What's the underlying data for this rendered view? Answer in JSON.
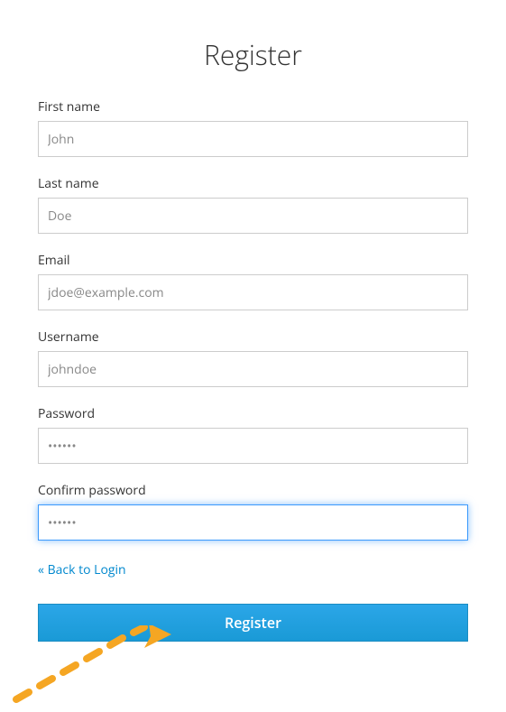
{
  "page": {
    "title": "Register"
  },
  "form": {
    "first_name": {
      "label": "First name",
      "value": "John"
    },
    "last_name": {
      "label": "Last name",
      "value": "Doe"
    },
    "email": {
      "label": "Email",
      "value": "jdoe@example.com"
    },
    "username": {
      "label": "Username",
      "value": "johndoe"
    },
    "password": {
      "label": "Password",
      "value": "••••••"
    },
    "confirm_password": {
      "label": "Confirm password",
      "value": "••••••"
    }
  },
  "links": {
    "back_to_login": "« Back to Login"
  },
  "buttons": {
    "register": "Register"
  },
  "annotation": {
    "arrow_color": "#f5a623"
  }
}
